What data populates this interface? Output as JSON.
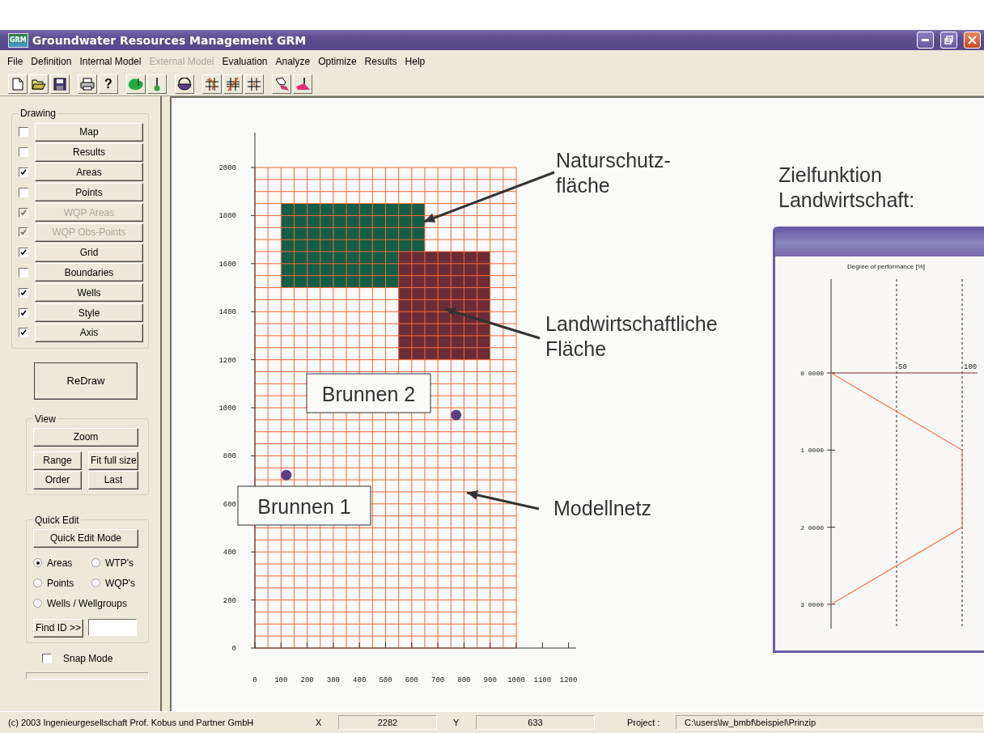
{
  "window": {
    "title": "Groundwater Resources Management GRM",
    "logo": "GRM"
  },
  "menu": [
    {
      "label": "File",
      "disabled": false
    },
    {
      "label": "Definition",
      "disabled": false
    },
    {
      "label": "Internal Model",
      "disabled": false
    },
    {
      "label": "External Model",
      "disabled": true
    },
    {
      "label": "Evaluation",
      "disabled": false
    },
    {
      "label": "Analyze",
      "disabled": false
    },
    {
      "label": "Optimize",
      "disabled": false
    },
    {
      "label": "Results",
      "disabled": false
    },
    {
      "label": "Help",
      "disabled": false
    }
  ],
  "toolbar": [
    [
      {
        "kind": "new"
      },
      {
        "kind": "open"
      },
      {
        "kind": "save"
      }
    ],
    [
      {
        "kind": "print"
      },
      {
        "kind": "help",
        "label": "?"
      }
    ],
    [
      {
        "kind": "blob"
      },
      {
        "kind": "pin"
      }
    ],
    [
      {
        "kind": "bucket"
      }
    ],
    [
      {
        "kind": "grid_edit"
      },
      {
        "kind": "grid_cut"
      },
      {
        "kind": "grid"
      }
    ],
    [
      {
        "kind": "map_pick"
      },
      {
        "kind": "map_point"
      }
    ]
  ],
  "drawing": {
    "title": "Drawing",
    "items": [
      {
        "label": "Map",
        "checked": false,
        "disabled": false
      },
      {
        "label": "Results",
        "checked": false,
        "disabled": false
      },
      {
        "label": "Areas",
        "checked": true,
        "disabled": false
      },
      {
        "label": "Points",
        "checked": false,
        "disabled": false
      },
      {
        "label": "WQP Areas",
        "checked": true,
        "disabled": true
      },
      {
        "label": "WQP Obs-Points",
        "checked": true,
        "disabled": true
      },
      {
        "label": "Grid",
        "checked": true,
        "disabled": false
      },
      {
        "label": "Boundaries",
        "checked": false,
        "disabled": false
      },
      {
        "label": "Wells",
        "checked": true,
        "disabled": false
      },
      {
        "label": "Style",
        "checked": true,
        "disabled": false
      },
      {
        "label": "Axis",
        "checked": true,
        "disabled": false
      }
    ]
  },
  "redraw_button": "ReDraw",
  "view": {
    "title": "View",
    "zoom_button": "Zoom",
    "buttons": [
      "Range",
      "Fit full size",
      "Order",
      "Last"
    ]
  },
  "quick_edit": {
    "title": "Quick Edit",
    "mode_button": "Quick Edit Mode",
    "options": [
      {
        "label": "Areas",
        "selected": true
      },
      {
        "label": "WTP's",
        "selected": false
      },
      {
        "label": "Points",
        "selected": false
      },
      {
        "label": "WQP's",
        "selected": false
      },
      {
        "label": "Wells / Wellgroups",
        "selected": false
      }
    ],
    "find_button": "Find ID >>"
  },
  "snap_mode": {
    "label": "Snap Mode",
    "checked": false
  },
  "plot": {
    "y_ticks": [
      "2000",
      "1800",
      "1600",
      "1400",
      "1200",
      "1000",
      "800",
      "600",
      "400",
      "200",
      "0"
    ],
    "x_ticks": [
      "0",
      "100",
      "200",
      "300",
      "400",
      "500",
      "600",
      "700",
      "800",
      "900",
      "1000",
      "1100",
      "1200"
    ],
    "areas": [
      {
        "kind": "nature_reserve",
        "color": "#145e44"
      },
      {
        "kind": "farmland",
        "color": "#6b2c35"
      }
    ],
    "wells": [
      {
        "label": "Brunnen 1"
      },
      {
        "label": "Brunnen 2"
      }
    ],
    "callouts": [
      {
        "text": "Naturschutz-\nfläche"
      },
      {
        "text": "Landwirtschaftliche\nFläche"
      },
      {
        "text": "Modellnetz"
      },
      {
        "text": "Zielfunktion\nLandwirtschaft:"
      }
    ]
  },
  "inset": {
    "title": "Degree of performance [%]",
    "column_labels": [
      "50",
      "100"
    ],
    "row_labels": [
      "0 0000",
      "1 0000",
      "2 0000",
      "3 0000"
    ]
  },
  "status_bar": {
    "copyright": "(c) 2003 Ingenieurgesellschaft Prof. Kobus und Partner GmbH",
    "x_label": "X",
    "x_value": "2282",
    "y_label": "Y",
    "y_value": "633",
    "project_label": "Project :",
    "project_path": "C:\\users\\lw_bmbf\\beispiel\\Prinzip"
  }
}
